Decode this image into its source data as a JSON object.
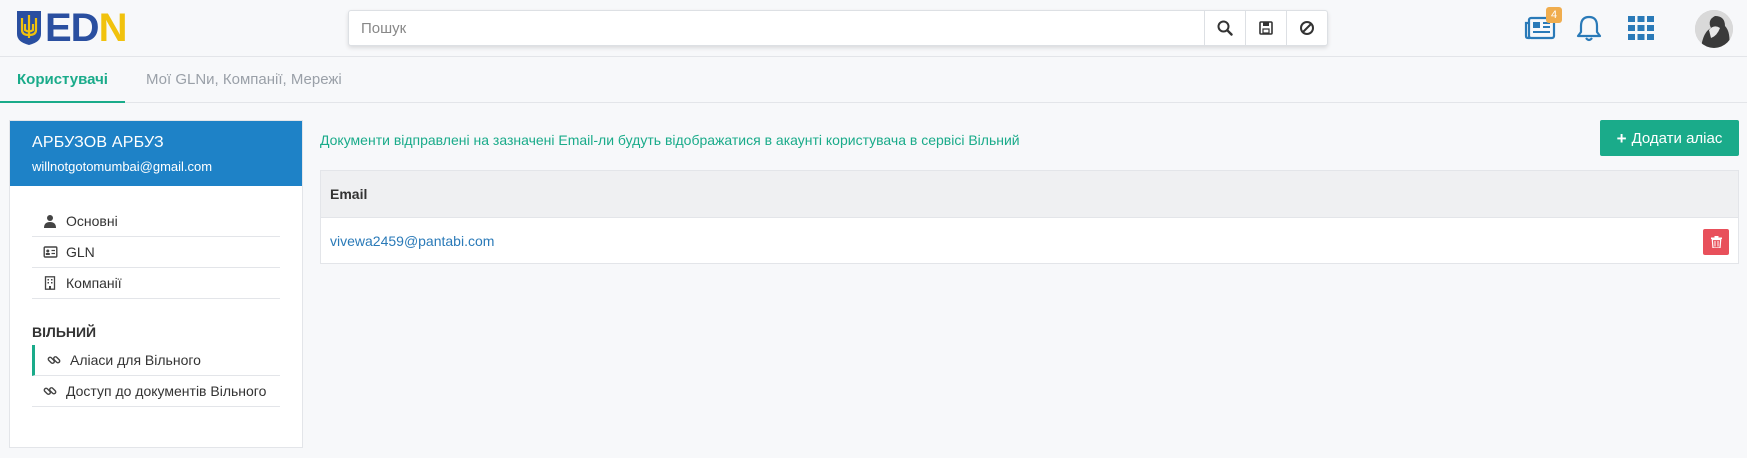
{
  "header": {
    "logo_text_ed": "ED",
    "logo_text_n": "N",
    "search_placeholder": "Пошук",
    "news_badge": "4",
    "icons": [
      "search-icon",
      "save-icon",
      "cancel-icon",
      "news-icon",
      "bell-icon",
      "apps-grid-icon",
      "avatar"
    ]
  },
  "tabs": [
    {
      "label": "Користувачі",
      "active": true
    },
    {
      "label": "Мої GLNи, Компанії, Мережі",
      "active": false
    }
  ],
  "user": {
    "name": "АРБУЗОВ АРБУЗ",
    "email": "willnotgotomumbai@gmail.com"
  },
  "menu": {
    "items": [
      {
        "label": "Основні",
        "icon": "user-icon"
      },
      {
        "label": "GLN",
        "icon": "id-card-icon"
      },
      {
        "label": "Компанії",
        "icon": "building-icon"
      }
    ],
    "section_title": "ВІЛЬНИЙ",
    "section_items": [
      {
        "label": "Аліаси для Вільного",
        "icon": "link-icon",
        "selected": true
      },
      {
        "label": "Доступ до документів Вільного",
        "icon": "link-icon",
        "selected": false
      }
    ]
  },
  "main": {
    "info_text": "Документи відправлені на зазначені Email-ли будуть відображатися в акаунті користувача в сервісі Вільний",
    "add_button_label": "Додати аліас",
    "table": {
      "columns": [
        "Email"
      ],
      "rows": [
        {
          "email": "vivewa2459@pantabi.com"
        }
      ]
    }
  },
  "colors": {
    "accent": "#1aab8a",
    "user_header": "#1e82c7",
    "delete": "#e8505b",
    "badge": "#f0ad4e"
  }
}
